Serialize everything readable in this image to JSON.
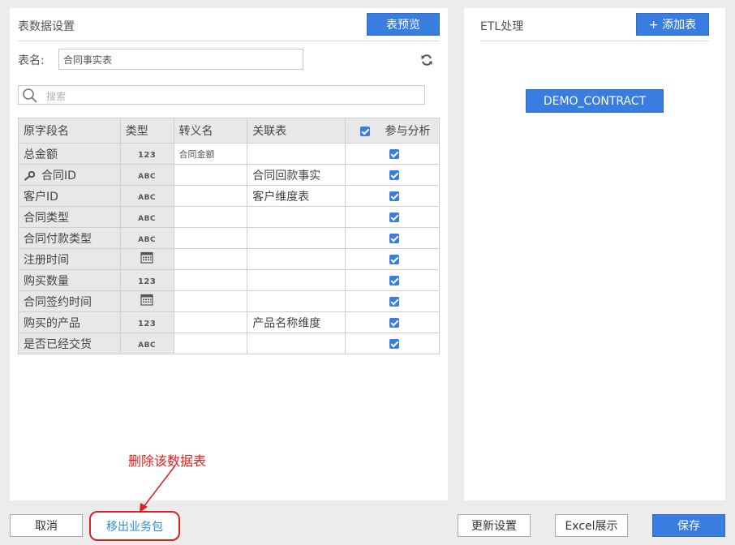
{
  "left_panel": {
    "title": "表数据设置",
    "preview_button": "表预览",
    "table_name_label": "表名:",
    "table_name_value": "合同事实表",
    "search_placeholder": "搜索"
  },
  "table": {
    "headers": [
      "原字段名",
      "类型",
      "转义名",
      "关联表",
      "参与分析"
    ],
    "rows": [
      {
        "field": "总金额",
        "type": "123",
        "alias": "合同金额",
        "relation": ""
      },
      {
        "field": "合同ID",
        "type": "ABC",
        "alias": "",
        "relation": "合同回款事实"
      },
      {
        "field": "客户ID",
        "type": "ABC",
        "alias": "",
        "relation": "客户维度表"
      },
      {
        "field": "合同类型",
        "type": "ABC",
        "alias": "",
        "relation": ""
      },
      {
        "field": "合同付款类型",
        "type": "ABC",
        "alias": "",
        "relation": ""
      },
      {
        "field": "注册时间",
        "type": "date",
        "alias": "",
        "relation": ""
      },
      {
        "field": "购买数量",
        "type": "123",
        "alias": "",
        "relation": ""
      },
      {
        "field": "合同签约时间",
        "type": "date",
        "alias": "",
        "relation": ""
      },
      {
        "field": "购买的产品",
        "type": "123",
        "alias": "",
        "relation": "产品名称维度"
      },
      {
        "field": "是否已经交货",
        "type": "ABC",
        "alias": "",
        "relation": ""
      }
    ]
  },
  "right_panel": {
    "title": "ETL处理",
    "add_button": "+ 添加表",
    "table_chip": "DEMO_CONTRACT"
  },
  "annotation": "删除该数据表",
  "footer": {
    "cancel": "取消",
    "remove_from_package": "移出业务包",
    "update_settings": "更新设置",
    "excel_view": "Excel展示",
    "save": "保存"
  },
  "colors": {
    "accent": "#3a7de0",
    "annotation": "#e02020",
    "link": "#2a8fd6"
  }
}
